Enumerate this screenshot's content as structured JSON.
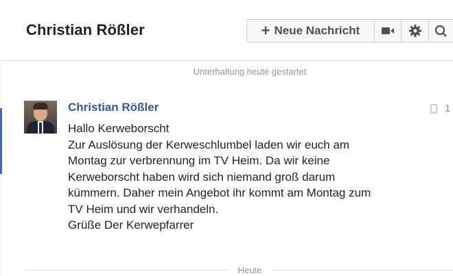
{
  "header": {
    "title": "Christian Rößler"
  },
  "toolbar": {
    "new_message_label": "Neue Nachricht",
    "icons": [
      "plus-icon",
      "video-call-icon",
      "gear-icon",
      "search-icon"
    ]
  },
  "conversation": {
    "start_divider": "Unterhaltung heute gestartet",
    "message": {
      "sender": "Christian Rößler",
      "time_fragment": "1",
      "lines": [
        "Hallo Kerweborscht",
        "Zur Auslösung der Kerweschlumbel laden wir euch am",
        "Montag zur verbrennung im TV Heim. Da wir keine",
        "Kerweborscht haben wird sich niemand groß darum",
        "kümmern. Daher mein Angebot ihr kommt am Montag zum",
        "TV Heim und wir verhandeln.",
        "Grüße Der Kerwepfarrer"
      ]
    },
    "day_divider": "Heute"
  },
  "colors": {
    "name_link": "#365899",
    "text": "#1d2129",
    "muted": "#90949c",
    "border": "#dddfe2",
    "accent": "#4267b2"
  }
}
